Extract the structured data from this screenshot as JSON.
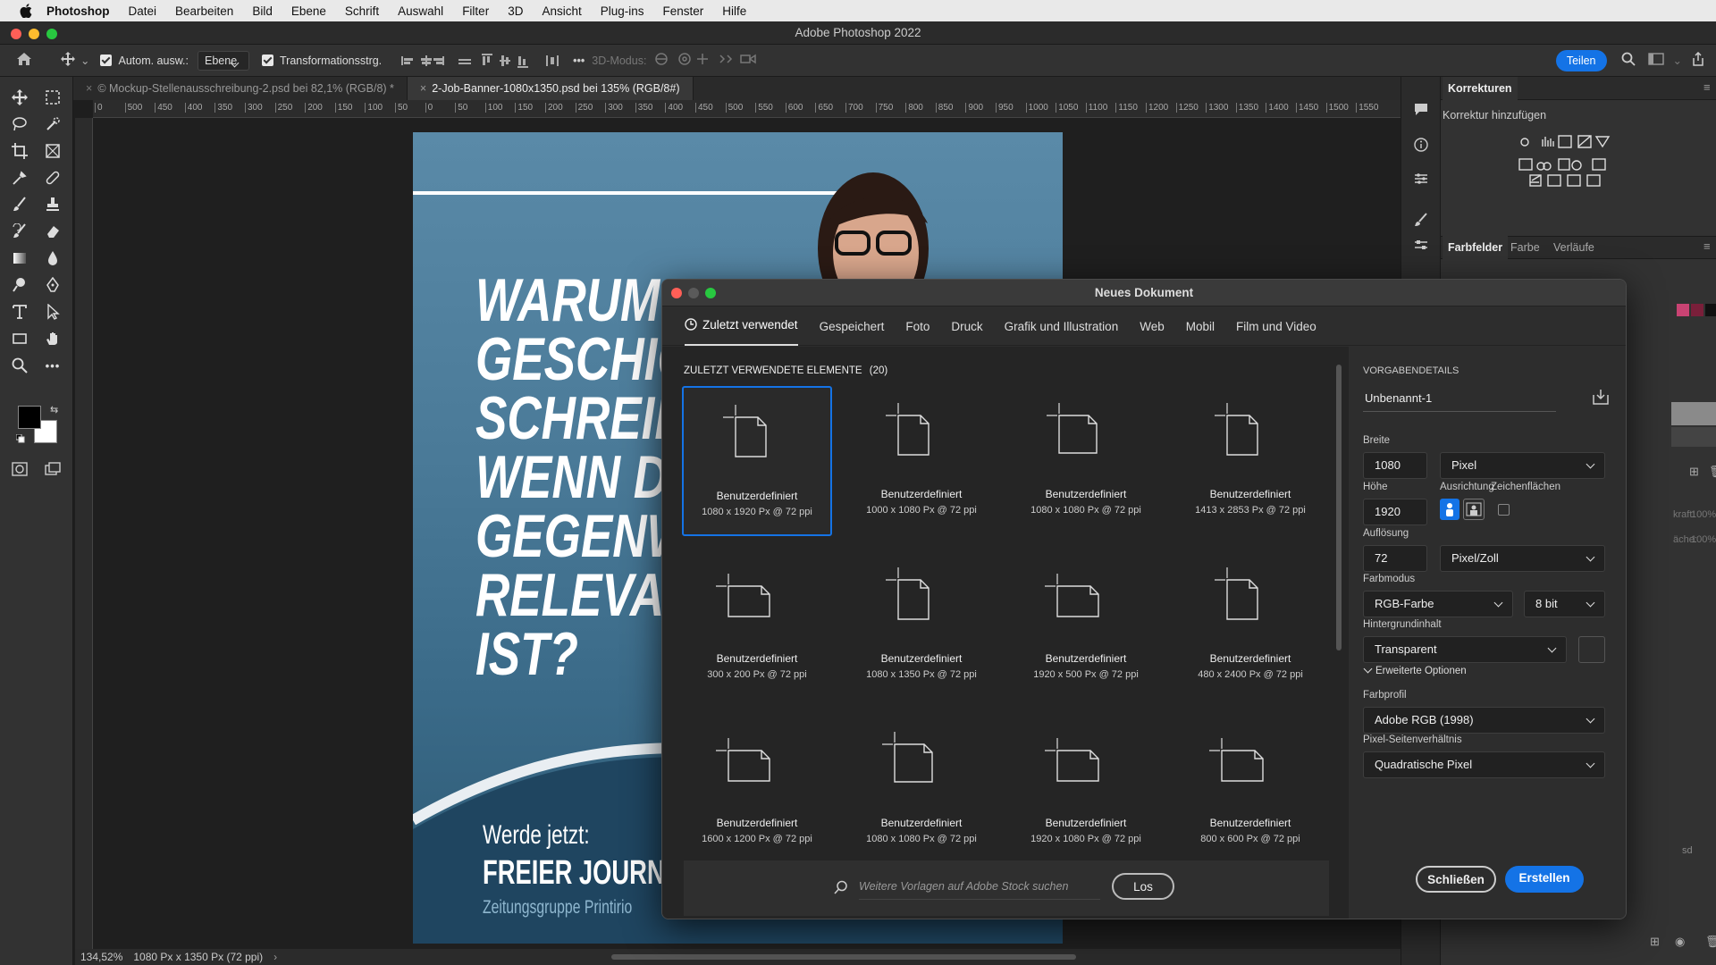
{
  "menubar": {
    "app": "Photoshop",
    "items": [
      "Datei",
      "Bearbeiten",
      "Bild",
      "Ebene",
      "Schrift",
      "Auswahl",
      "Filter",
      "3D",
      "Ansicht",
      "Plug-ins",
      "Fenster",
      "Hilfe"
    ]
  },
  "window": {
    "title": "Adobe Photoshop 2022"
  },
  "options": {
    "auto_select_label": "Autom. ausw.:",
    "auto_select_value": "Ebene",
    "transform_label": "Transformationsstrg.",
    "mode3d_label": "3D-Modus:",
    "share_label": "Teilen"
  },
  "doc_tabs": [
    {
      "label": "© Mockup-Stellenausschreibung-2.psd bei 82,1% (RGB/8) *"
    },
    {
      "label": "2-Job-Banner-1080x1350.psd bei 135% (RGB/8#)"
    }
  ],
  "ruler_ticks": [
    "0",
    "500",
    "450",
    "400",
    "350",
    "300",
    "250",
    "200",
    "150",
    "100",
    "50",
    "0",
    "50",
    "100",
    "150",
    "200",
    "250",
    "300",
    "350",
    "400",
    "450",
    "500",
    "550",
    "600",
    "650",
    "700",
    "750",
    "800",
    "850",
    "900",
    "950",
    "1000",
    "1050",
    "1100",
    "1150",
    "1200",
    "1250",
    "1300",
    "1350",
    "1400",
    "1450",
    "1500",
    "1550"
  ],
  "poster": {
    "headline": [
      "WARUM",
      "GESCHIC",
      "SCHREIB",
      "WENN D",
      "GEGENW",
      "RELEVAI",
      "IST?"
    ],
    "cta_small": "Werde jetzt:",
    "cta_big": "FREIER JOURNALI",
    "company": "Zeitungsgruppe Printirio"
  },
  "status": {
    "zoom": "134,52%",
    "doc_info": "1080 Px x 1350 Px (72 ppi)"
  },
  "right_panel": {
    "title": "Korrekturen",
    "add_label": "Korrektur hinzufügen",
    "tabs": [
      "Farbfelder",
      "Farbe",
      "Verläufe"
    ],
    "obscured_1": "kraft:",
    "obscured_1_val": "100%",
    "obscured_2": "äche:",
    "obscured_2_val": "100%",
    "obscured_3": "sd"
  },
  "dialog": {
    "title": "Neues Dokument",
    "tabs": [
      "Zuletzt verwendet",
      "Gespeichert",
      "Foto",
      "Druck",
      "Grafik und Illustration",
      "Web",
      "Mobil",
      "Film und Video"
    ],
    "section_title": "ZULETZT VERWENDETE ELEMENTE",
    "section_count": "(20)",
    "presets": [
      {
        "name": "Benutzerdefiniert",
        "dim": "1080 x 1920 Px @ 72 ppi",
        "orient": "portrait"
      },
      {
        "name": "Benutzerdefiniert",
        "dim": "1000 x 1080 Px @ 72 ppi",
        "orient": "portrait"
      },
      {
        "name": "Benutzerdefiniert",
        "dim": "1080 x 1080 Px @ 72 ppi",
        "orient": "square"
      },
      {
        "name": "Benutzerdefiniert",
        "dim": "1413 x 2853 Px @ 72 ppi",
        "orient": "portrait"
      },
      {
        "name": "Benutzerdefiniert",
        "dim": "300 x 200 Px @ 72 ppi",
        "orient": "landscape"
      },
      {
        "name": "Benutzerdefiniert",
        "dim": "1080 x 1350 Px @ 72 ppi",
        "orient": "portrait"
      },
      {
        "name": "Benutzerdefiniert",
        "dim": "1920 x 500 Px @ 72 ppi",
        "orient": "landscape"
      },
      {
        "name": "Benutzerdefiniert",
        "dim": "480 x 2400 Px @ 72 ppi",
        "orient": "portrait"
      },
      {
        "name": "Benutzerdefiniert",
        "dim": "1600 x 1200 Px @ 72 ppi",
        "orient": "landscape"
      },
      {
        "name": "Benutzerdefiniert",
        "dim": "1080 x 1080 Px @ 72 ppi",
        "orient": "square"
      },
      {
        "name": "Benutzerdefiniert",
        "dim": "1920 x 1080 Px @ 72 ppi",
        "orient": "landscape"
      },
      {
        "name": "Benutzerdefiniert",
        "dim": "800 x 600 Px @ 72 ppi",
        "orient": "landscape"
      }
    ],
    "search_placeholder": "Weitere Vorlagen auf Adobe Stock suchen",
    "go_label": "Los",
    "details": {
      "section": "VORGABENDETAILS",
      "name": "Unbenannt-1",
      "width_label": "Breite",
      "width_value": "1080",
      "width_unit": "Pixel",
      "height_label": "Höhe",
      "height_value": "1920",
      "orientation_label": "Ausrichtung",
      "artboards_label": "Zeichenflächen",
      "resolution_label": "Auflösung",
      "resolution_value": "72",
      "resolution_unit": "Pixel/Zoll",
      "color_mode_label": "Farbmodus",
      "color_mode": "RGB-Farbe",
      "bit_depth": "8 bit",
      "background_label": "Hintergrundinhalt",
      "background": "Transparent",
      "advanced_label": "Erweiterte Optionen",
      "profile_label": "Farbprofil",
      "profile": "Adobe RGB (1998)",
      "pixel_ratio_label": "Pixel-Seitenverhältnis",
      "pixel_ratio": "Quadratische Pixel"
    },
    "close_label": "Schließen",
    "create_label": "Erstellen"
  },
  "colors": {
    "accent": "#1473e6"
  }
}
